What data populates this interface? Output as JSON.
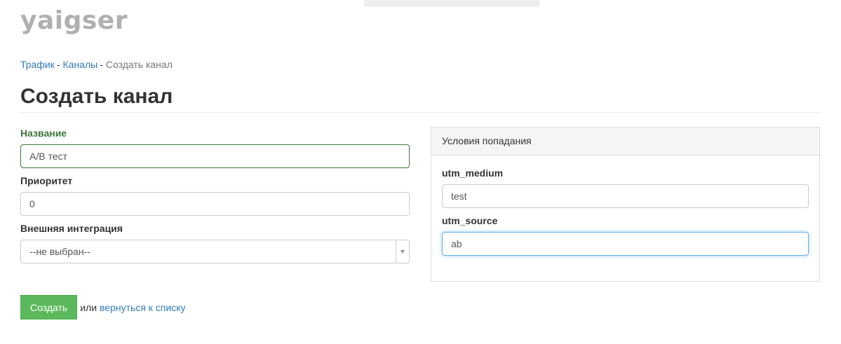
{
  "brand": {
    "logo_text": "yaigser"
  },
  "breadcrumb": {
    "items": [
      "Трафик",
      "Каналы"
    ],
    "separator": "-",
    "current": "Создать канал"
  },
  "page": {
    "title": "Создать канал"
  },
  "form": {
    "name": {
      "label": "Название",
      "value": "А/В тест"
    },
    "priority": {
      "label": "Приоритет",
      "value": "0"
    },
    "integration": {
      "label": "Внешняя интеграция",
      "selected": "--не выбран--"
    },
    "submit_label": "Создать",
    "or_text": "или",
    "back_link": "вернуться к списку"
  },
  "conditions": {
    "heading": "Условия попадания",
    "utm_medium": {
      "label": "utm_medium",
      "value": "test"
    },
    "utm_source": {
      "label": "utm_source",
      "value": "ab"
    }
  },
  "colors": {
    "link": "#337ab7",
    "success_label": "#3c763d",
    "button_green": "#5cb85c",
    "logo_gray": "#b0b0b0",
    "focus_blue": "#66afe9"
  },
  "icons": {
    "select_arrow": "triangle-down"
  }
}
